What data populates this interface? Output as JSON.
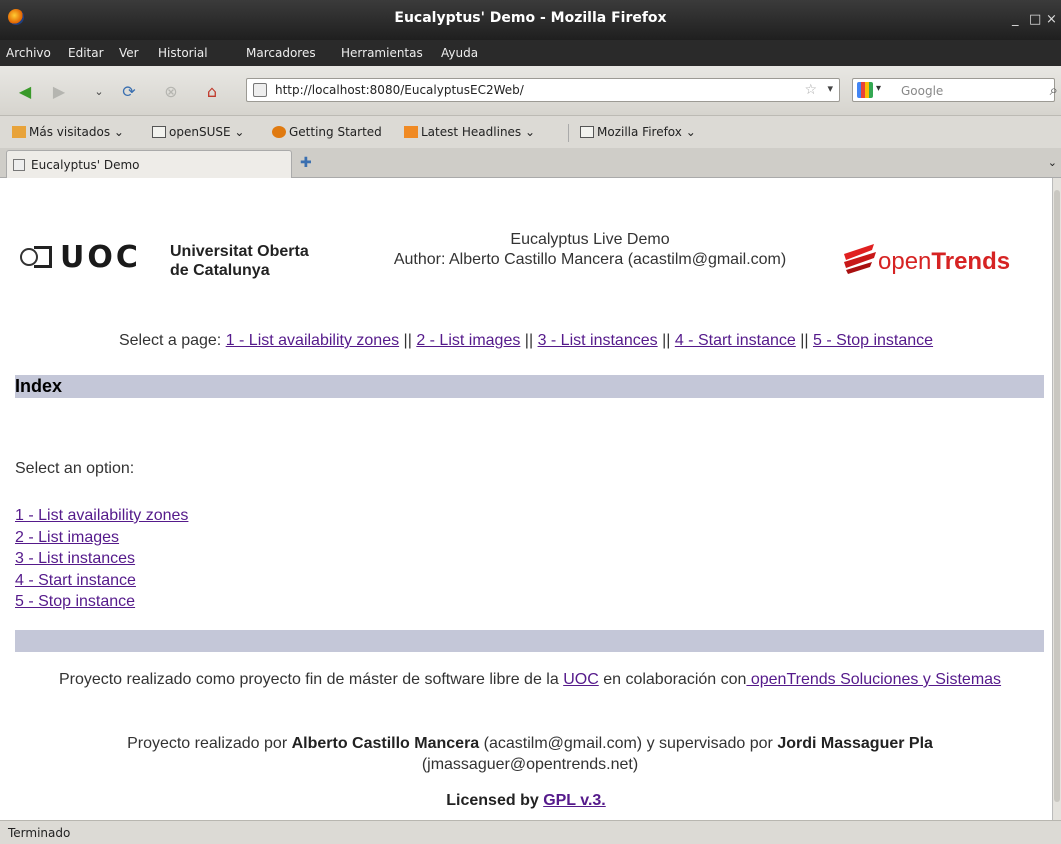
{
  "window": {
    "title": "Eucalyptus' Demo - Mozilla Firefox",
    "controls": [
      "_",
      "□",
      "×"
    ]
  },
  "menubar": [
    "Archivo",
    "Editar",
    "Ver",
    "Historial",
    "Marcadores",
    "Herramientas",
    "Ayuda"
  ],
  "toolbar": {
    "url": "http://localhost:8080/EucalyptusEC2Web/",
    "search_placeholder": "Google"
  },
  "bookmarks": [
    "Más visitados",
    "openSUSE",
    "Getting Started",
    "Latest Headlines",
    "Mozilla Firefox"
  ],
  "tabs": [
    {
      "label": "Eucalyptus' Demo"
    }
  ],
  "page": {
    "uoc_logo_text": "UOC",
    "uoc_name_line1": "Universitat Oberta",
    "uoc_name_line2": "de Catalunya",
    "header_title": "Eucalyptus Live Demo",
    "header_author": "Author: Alberto Castillo Mancera (acastilm@gmail.com)",
    "opentrends_open": "open",
    "opentrends_trends": "Trends",
    "select_prefix": "Select a page: ",
    "separator": " || ",
    "nav_links": [
      "1 - List availability zones",
      "2 - List images",
      "3 - List instances",
      "4 - Start instance",
      "5 - Stop instance"
    ],
    "index_heading": "Index",
    "select_option": "Select an option:",
    "options": [
      "1 - List availability zones",
      "2 - List images",
      "3 - List instances",
      "4 - Start instance",
      "5 - Stop instance"
    ],
    "footer1_text": "Proyecto realizado como proyecto fin de máster de software libre de la ",
    "footer1_uoc": "UOC",
    "footer1_mid": " en colaboración con",
    "footer1_link": " openTrends Soluciones y Sistemas",
    "footer2_a": "Proyecto realizado por ",
    "footer2_author": "Alberto Castillo Mancera",
    "footer2_b": " (acastilm@gmail.com) y supervisado por ",
    "footer2_supervisor": "Jordi Massaguer Pla",
    "footer2_c": " (jmassaguer@opentrends.net)",
    "license_prefix": "Licensed by ",
    "license_link": "GPL v.3."
  },
  "status": "Terminado",
  "colors": {
    "section_bar": "#c4c7d8",
    "link": "#551a8b",
    "brand_red": "#d62323"
  }
}
